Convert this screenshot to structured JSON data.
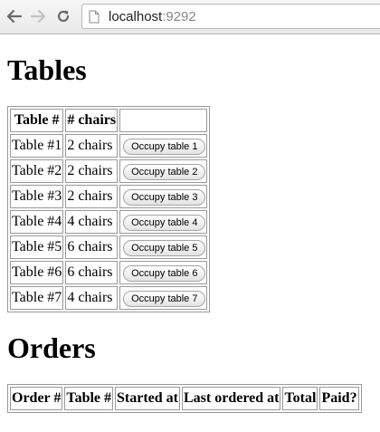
{
  "browser": {
    "url_host": "localhost",
    "url_port": ":9292"
  },
  "tables_section": {
    "heading": "Tables",
    "columns": [
      "Table #",
      "# chairs",
      ""
    ],
    "rows": [
      {
        "table": "Table #1",
        "chairs": "2 chairs",
        "button": "Occupy table 1"
      },
      {
        "table": "Table #2",
        "chairs": "2 chairs",
        "button": "Occupy table 2"
      },
      {
        "table": "Table #3",
        "chairs": "2 chairs",
        "button": "Occupy table 3"
      },
      {
        "table": "Table #4",
        "chairs": "4 chairs",
        "button": "Occupy table 4"
      },
      {
        "table": "Table #5",
        "chairs": "6 chairs",
        "button": "Occupy table 5"
      },
      {
        "table": "Table #6",
        "chairs": "6 chairs",
        "button": "Occupy table 6"
      },
      {
        "table": "Table #7",
        "chairs": "4 chairs",
        "button": "Occupy table 7"
      }
    ]
  },
  "orders_section": {
    "heading": "Orders",
    "columns": [
      "Order #",
      "Table #",
      "Started at",
      "Last ordered at",
      "Total",
      "Paid?"
    ]
  },
  "icons": {
    "back": "back-arrow-icon",
    "forward": "forward-arrow-icon",
    "reload": "reload-icon",
    "page": "page-icon"
  }
}
